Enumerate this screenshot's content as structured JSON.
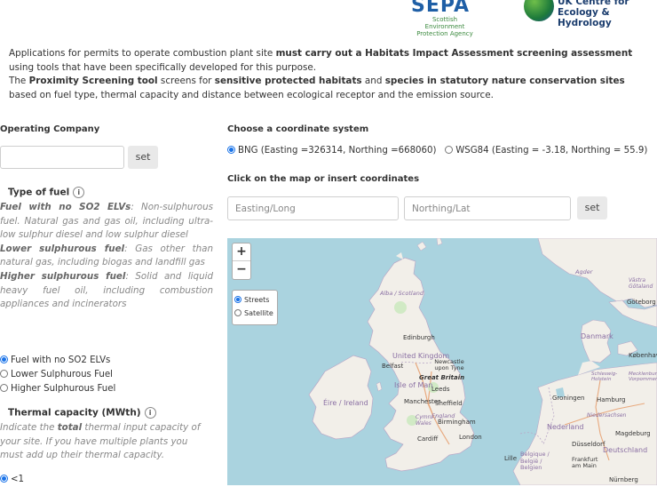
{
  "logos": {
    "sepa": {
      "word": "SEPA",
      "sub": "Scottish Environment Protection Agency"
    },
    "ukceh": {
      "line1": "UK Centre for",
      "line2": "Ecology & Hydrology"
    }
  },
  "intro": {
    "p1_a": "Applications for permits to operate combustion plant site ",
    "p1_b": "must carry out a Habitats Impact Assessment screening assessment",
    "p1_c": " using tools that have been specifically developed for this purpose.",
    "p2_a": "The ",
    "p2_b": "Proximity Screening tool",
    "p2_c": " screens for ",
    "p2_d": "sensitive protected habitats",
    "p2_e": " and ",
    "p2_f": "species in statutory nature conservation sites",
    "p2_g": " based on fuel type, thermal capacity and distance between ecological receptor and the emission source."
  },
  "operating_company": {
    "label": "Operating Company",
    "value": "",
    "set": "set"
  },
  "fuel": {
    "title": "Type of fuel",
    "info": "i",
    "d1_b": "Fuel with no SO2 ELVs",
    "d1": ": Non-sulphurous fuel. Natural gas and gas oil, including ultra-low sulphur diesel and low sulphur diesel",
    "d2_b": "Lower sulphurous fuel",
    "d2": ": Gas other than natural gas, including biogas and landfill gas",
    "d3_b": "Higher sulphurous fuel",
    "d3": ": Solid and liquid heavy fuel oil, including combustion appliances and incinerators",
    "options": [
      "Fuel with no SO2 ELVs",
      "Lower Sulphurous Fuel",
      "Higher Sulphurous Fuel"
    ],
    "selected": 0
  },
  "thermal": {
    "title": "Thermal capacity (MWth)",
    "info": "i",
    "d_a": "Indicate the ",
    "d_b": "total",
    "d_c": " thermal input capacity of your site. If you have multiple plants you must add up their thermal capacity.",
    "options": [
      "<1"
    ],
    "selected": 0
  },
  "coords": {
    "label": "Choose a coordinate system",
    "bng": "BNG (Easting =326314, Northing =668060)",
    "wgs": "WSG84 (Easting = -3.18, Northing = 55.9)",
    "selected": "bng",
    "click_label": "Click on the map or insert coordinates",
    "easting_placeholder": "Easting/Long",
    "northing_placeholder": "Northing/Lat",
    "set": "set"
  },
  "map": {
    "zoom_in": "+",
    "zoom_out": "−",
    "layers": [
      "Streets",
      "Satellite"
    ],
    "selected_layer": "Streets",
    "labels": {
      "alba": "Alba / Scotland",
      "edinburgh": "Edinburgh",
      "uk": "United Kingdom",
      "belfast": "Belfast",
      "newcastle": "Newcastle upon Tyne",
      "gb": "Great Britain",
      "isle_of_man": "Isle of Man",
      "leeds": "Leeds",
      "manchester": "Manchester",
      "sheffield": "Sheffield",
      "eire": "Éire / Ireland",
      "england": "England",
      "cymru": "Cymru / Wales",
      "birmingham": "Birmingham",
      "cardiff": "Cardiff",
      "london": "London",
      "agder": "Agder",
      "vastra": "Västra Götaland",
      "goteborg": "Göteborg",
      "danmark": "Danmark",
      "kobenhavn": "København",
      "schleswig": "Schleswig-Holstein",
      "mecklenburg": "Mecklenburg-Vorpommern",
      "groningen": "Groningen",
      "hamburg": "Hamburg",
      "niedersachsen": "Niedersachsen",
      "nederland": "Nederland",
      "magdeburg": "Magdeburg",
      "dusseldorf": "Düsseldorf",
      "deutschland": "Deutschland",
      "lille": "Lille",
      "belgique": "Belgique / België / Belgien",
      "frankfurt": "Frankfurt am Main",
      "nurnberg": "Nürnberg"
    }
  }
}
